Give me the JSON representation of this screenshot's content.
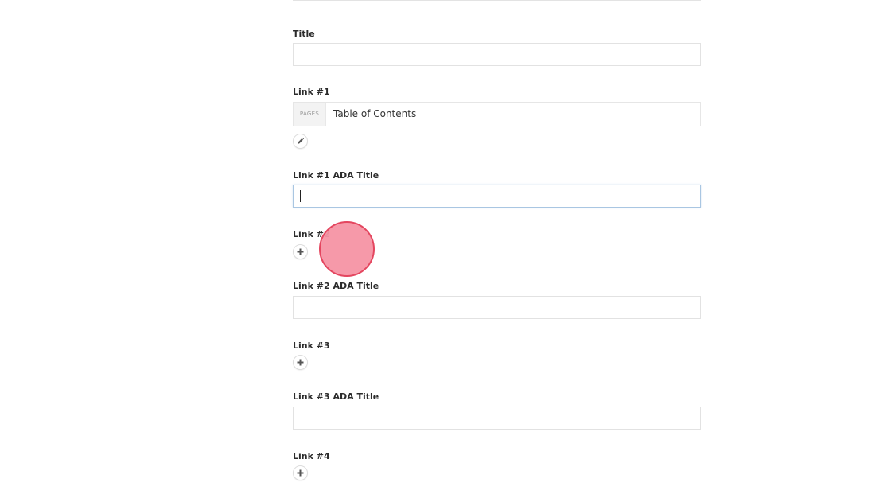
{
  "form": {
    "title_field": {
      "label": "Title",
      "value": ""
    },
    "link1": {
      "label": "Link #1",
      "type_tag": "PAGES",
      "value": "Table of Contents",
      "action_icon": "pencil-icon"
    },
    "link1_ada": {
      "label": "Link #1 ADA Title",
      "value": ""
    },
    "link2": {
      "label": "Link #2",
      "action_icon": "plus-icon"
    },
    "link2_ada": {
      "label": "Link #2 ADA Title",
      "value": ""
    },
    "link3": {
      "label": "Link #3",
      "action_icon": "plus-icon"
    },
    "link3_ada": {
      "label": "Link #3 ADA Title",
      "value": ""
    },
    "link4": {
      "label": "Link #4",
      "action_icon": "plus-icon"
    }
  },
  "colors": {
    "focus_border": "#a9c6e2",
    "click_indicator_fill": "#f694a4",
    "click_indicator_stroke": "#e4465f"
  }
}
